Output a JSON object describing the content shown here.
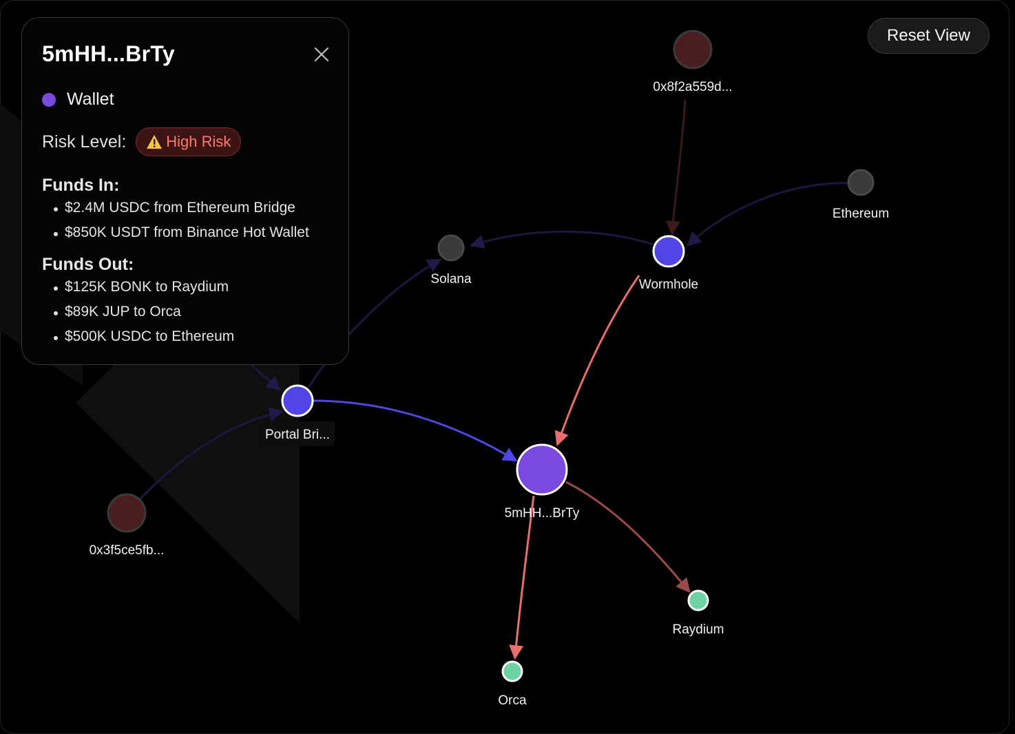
{
  "toolbar": {
    "reset_label": "Reset View"
  },
  "panel": {
    "title": "5mHH...BrTy",
    "type_label": "Wallet",
    "type_color": "#7b49e0",
    "risk_label": "Risk Level:",
    "risk_badge": "High Risk",
    "risk_icon": "warning-icon",
    "funds_in_title": "Funds In:",
    "funds_in": [
      "$2.4M USDC from Ethereum Bridge",
      "$850K USDT from Binance Hot Wallet"
    ],
    "funds_out_title": "Funds Out:",
    "funds_out": [
      "$125K BONK to Raydium",
      "$89K JUP to Orca",
      "$500K USDC to Ethereum"
    ],
    "close_icon": "close-icon"
  },
  "graph": {
    "nodes": [
      {
        "id": "n0x8f",
        "label": "0x8f2a559d...",
        "kind": "risky-address"
      },
      {
        "id": "eth",
        "label": "Ethereum",
        "kind": "chain"
      },
      {
        "id": "sol",
        "label": "Solana",
        "kind": "chain"
      },
      {
        "id": "wormhole",
        "label": "Wormhole",
        "kind": "bridge"
      },
      {
        "id": "portal",
        "label": "Portal Bri...",
        "kind": "bridge"
      },
      {
        "id": "wallet",
        "label": "5mHH...BrTy",
        "kind": "wallet"
      },
      {
        "id": "n0x3f",
        "label": "0x3f5ce5fb...",
        "kind": "risky-address"
      },
      {
        "id": "raydium",
        "label": "Raydium",
        "kind": "dex"
      },
      {
        "id": "orca",
        "label": "Orca",
        "kind": "dex"
      }
    ],
    "edges": [
      {
        "from": "n0x8f",
        "to": "wormhole"
      },
      {
        "from": "eth",
        "to": "wormhole"
      },
      {
        "from": "wormhole",
        "to": "sol"
      },
      {
        "from": "wormhole",
        "to": "wallet"
      },
      {
        "from": "portal",
        "to": "sol"
      },
      {
        "from": "n0x3f",
        "to": "portal"
      },
      {
        "from": "portal",
        "to": "wallet"
      },
      {
        "from": "wallet",
        "to": "raydium"
      },
      {
        "from": "wallet",
        "to": "orca"
      }
    ],
    "colors": {
      "wallet": "#7b49e0",
      "bridge": "#5046e6",
      "dex": "#6dd3a0",
      "chain": "#3a3a3a",
      "risky": "#4a1e1e",
      "edge_in": "#ea6e6e",
      "edge_blue": "#5046e6",
      "edge_faint": "#1c1740",
      "edge_out": "#9a4a48"
    }
  }
}
